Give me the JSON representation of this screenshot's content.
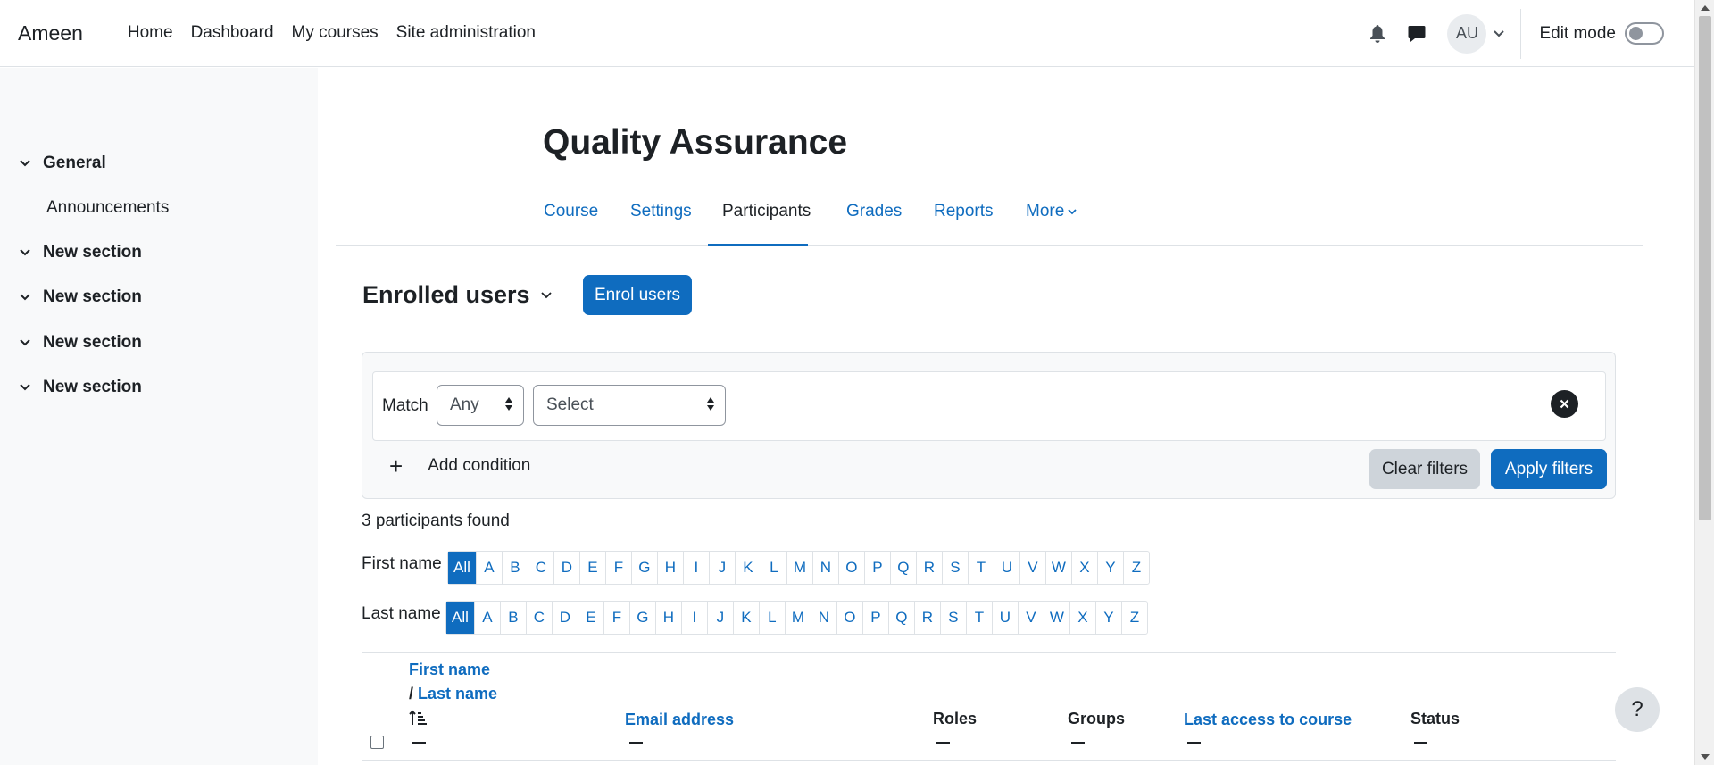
{
  "navbar": {
    "brand": "Ameen",
    "links": [
      "Home",
      "Dashboard",
      "My courses",
      "Site administration"
    ],
    "avatar_initials": "AU",
    "edit_mode_label": "Edit mode",
    "edit_mode_on": false
  },
  "course_index": {
    "sections": [
      {
        "label": "General",
        "items": [
          "Announcements"
        ]
      },
      {
        "label": "New section"
      },
      {
        "label": "New section"
      },
      {
        "label": "New section"
      },
      {
        "label": "New section"
      }
    ]
  },
  "page": {
    "title": "Quality Assurance",
    "tabs": [
      "Course",
      "Settings",
      "Participants",
      "Grades",
      "Reports",
      "More"
    ],
    "active_tab": "Participants",
    "heading": "Enrolled users",
    "enrol_button": "Enrol users"
  },
  "filters": {
    "match_label": "Match",
    "match_value": "Any",
    "type_value": "Select",
    "add_condition": "Add condition",
    "clear_button": "Clear filters",
    "apply_button": "Apply filters"
  },
  "participants": {
    "found_text": "3 participants found",
    "first_name_label": "First name",
    "last_name_label": "Last name",
    "letters": [
      "All",
      "A",
      "B",
      "C",
      "D",
      "E",
      "F",
      "G",
      "H",
      "I",
      "J",
      "K",
      "L",
      "M",
      "N",
      "O",
      "P",
      "Q",
      "R",
      "S",
      "T",
      "U",
      "V",
      "W",
      "X",
      "Y",
      "Z"
    ]
  },
  "table": {
    "col_firstname": "First name",
    "col_separator": "/",
    "col_lastname": "Last name",
    "col_email": "Email address",
    "col_roles": "Roles",
    "col_groups": "Groups",
    "col_lastaccess": "Last access to course",
    "col_status": "Status"
  },
  "help": {
    "label": "?"
  },
  "colors": {
    "primary": "#0f6cbf",
    "drawer_bg": "#f8f9fa",
    "text": "#1d2125"
  }
}
